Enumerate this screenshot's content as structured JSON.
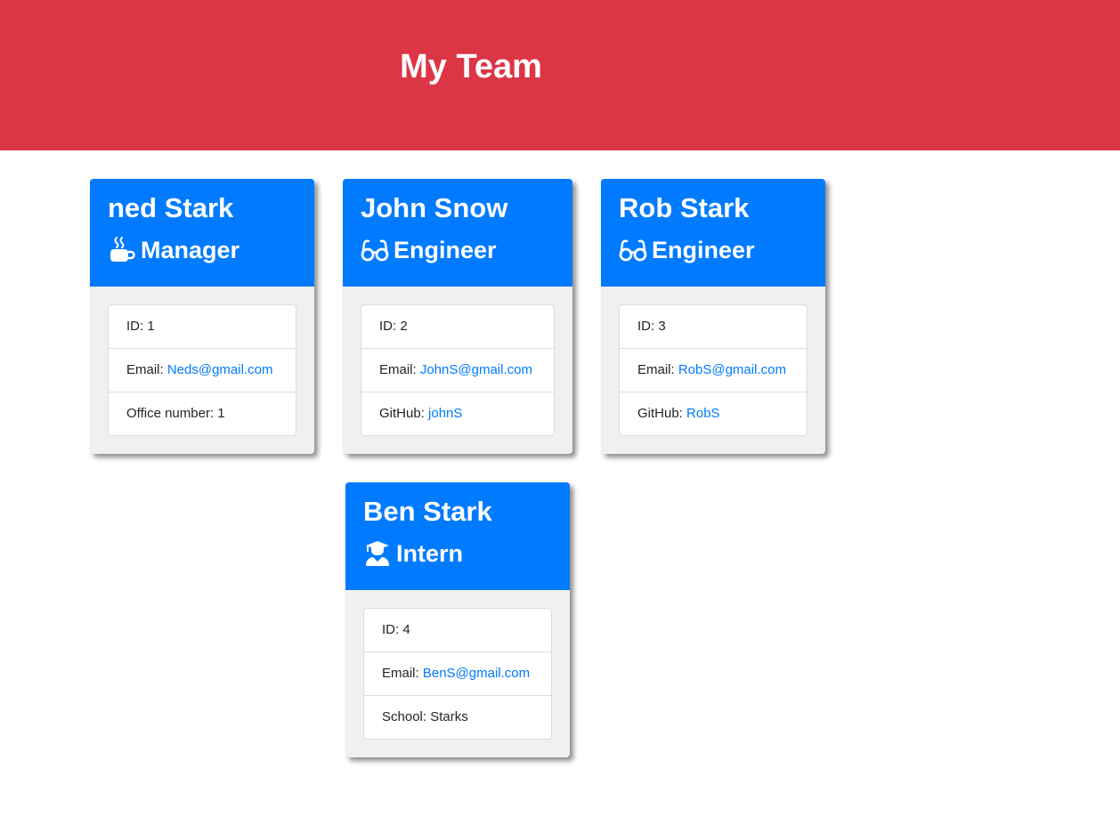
{
  "header": {
    "title": "My Team"
  },
  "colors": {
    "header_bg": "#dc3545",
    "card_header_bg": "#007bff",
    "link": "#007bff",
    "card_body_bg": "#f0f0f0"
  },
  "cards": [
    {
      "name": "ned Stark",
      "role": "Manager",
      "role_icon": "mug-icon",
      "id_label": "ID: ",
      "id": "1",
      "email_label": "Email: ",
      "email": "Neds@gmail.com",
      "extra_label": "Office number: ",
      "extra_value": "1"
    },
    {
      "name": "John Snow",
      "role": "Engineer",
      "role_icon": "glasses-icon",
      "id_label": "ID: ",
      "id": "2",
      "email_label": "Email: ",
      "email": "JohnS@gmail.com",
      "extra_label": "GitHub: ",
      "extra_value": "johnS"
    },
    {
      "name": "Rob Stark",
      "role": "Engineer",
      "role_icon": "glasses-icon",
      "id_label": "ID: ",
      "id": "3",
      "email_label": "Email: ",
      "email": "RobS@gmail.com",
      "extra_label": "GitHub: ",
      "extra_value": "RobS"
    },
    {
      "name": "Ben Stark",
      "role": "Intern",
      "role_icon": "graduate-icon",
      "id_label": "ID: ",
      "id": "4",
      "email_label": "Email: ",
      "email": "BenS@gmail.com",
      "extra_label": "School: ",
      "extra_value": "Starks"
    }
  ]
}
